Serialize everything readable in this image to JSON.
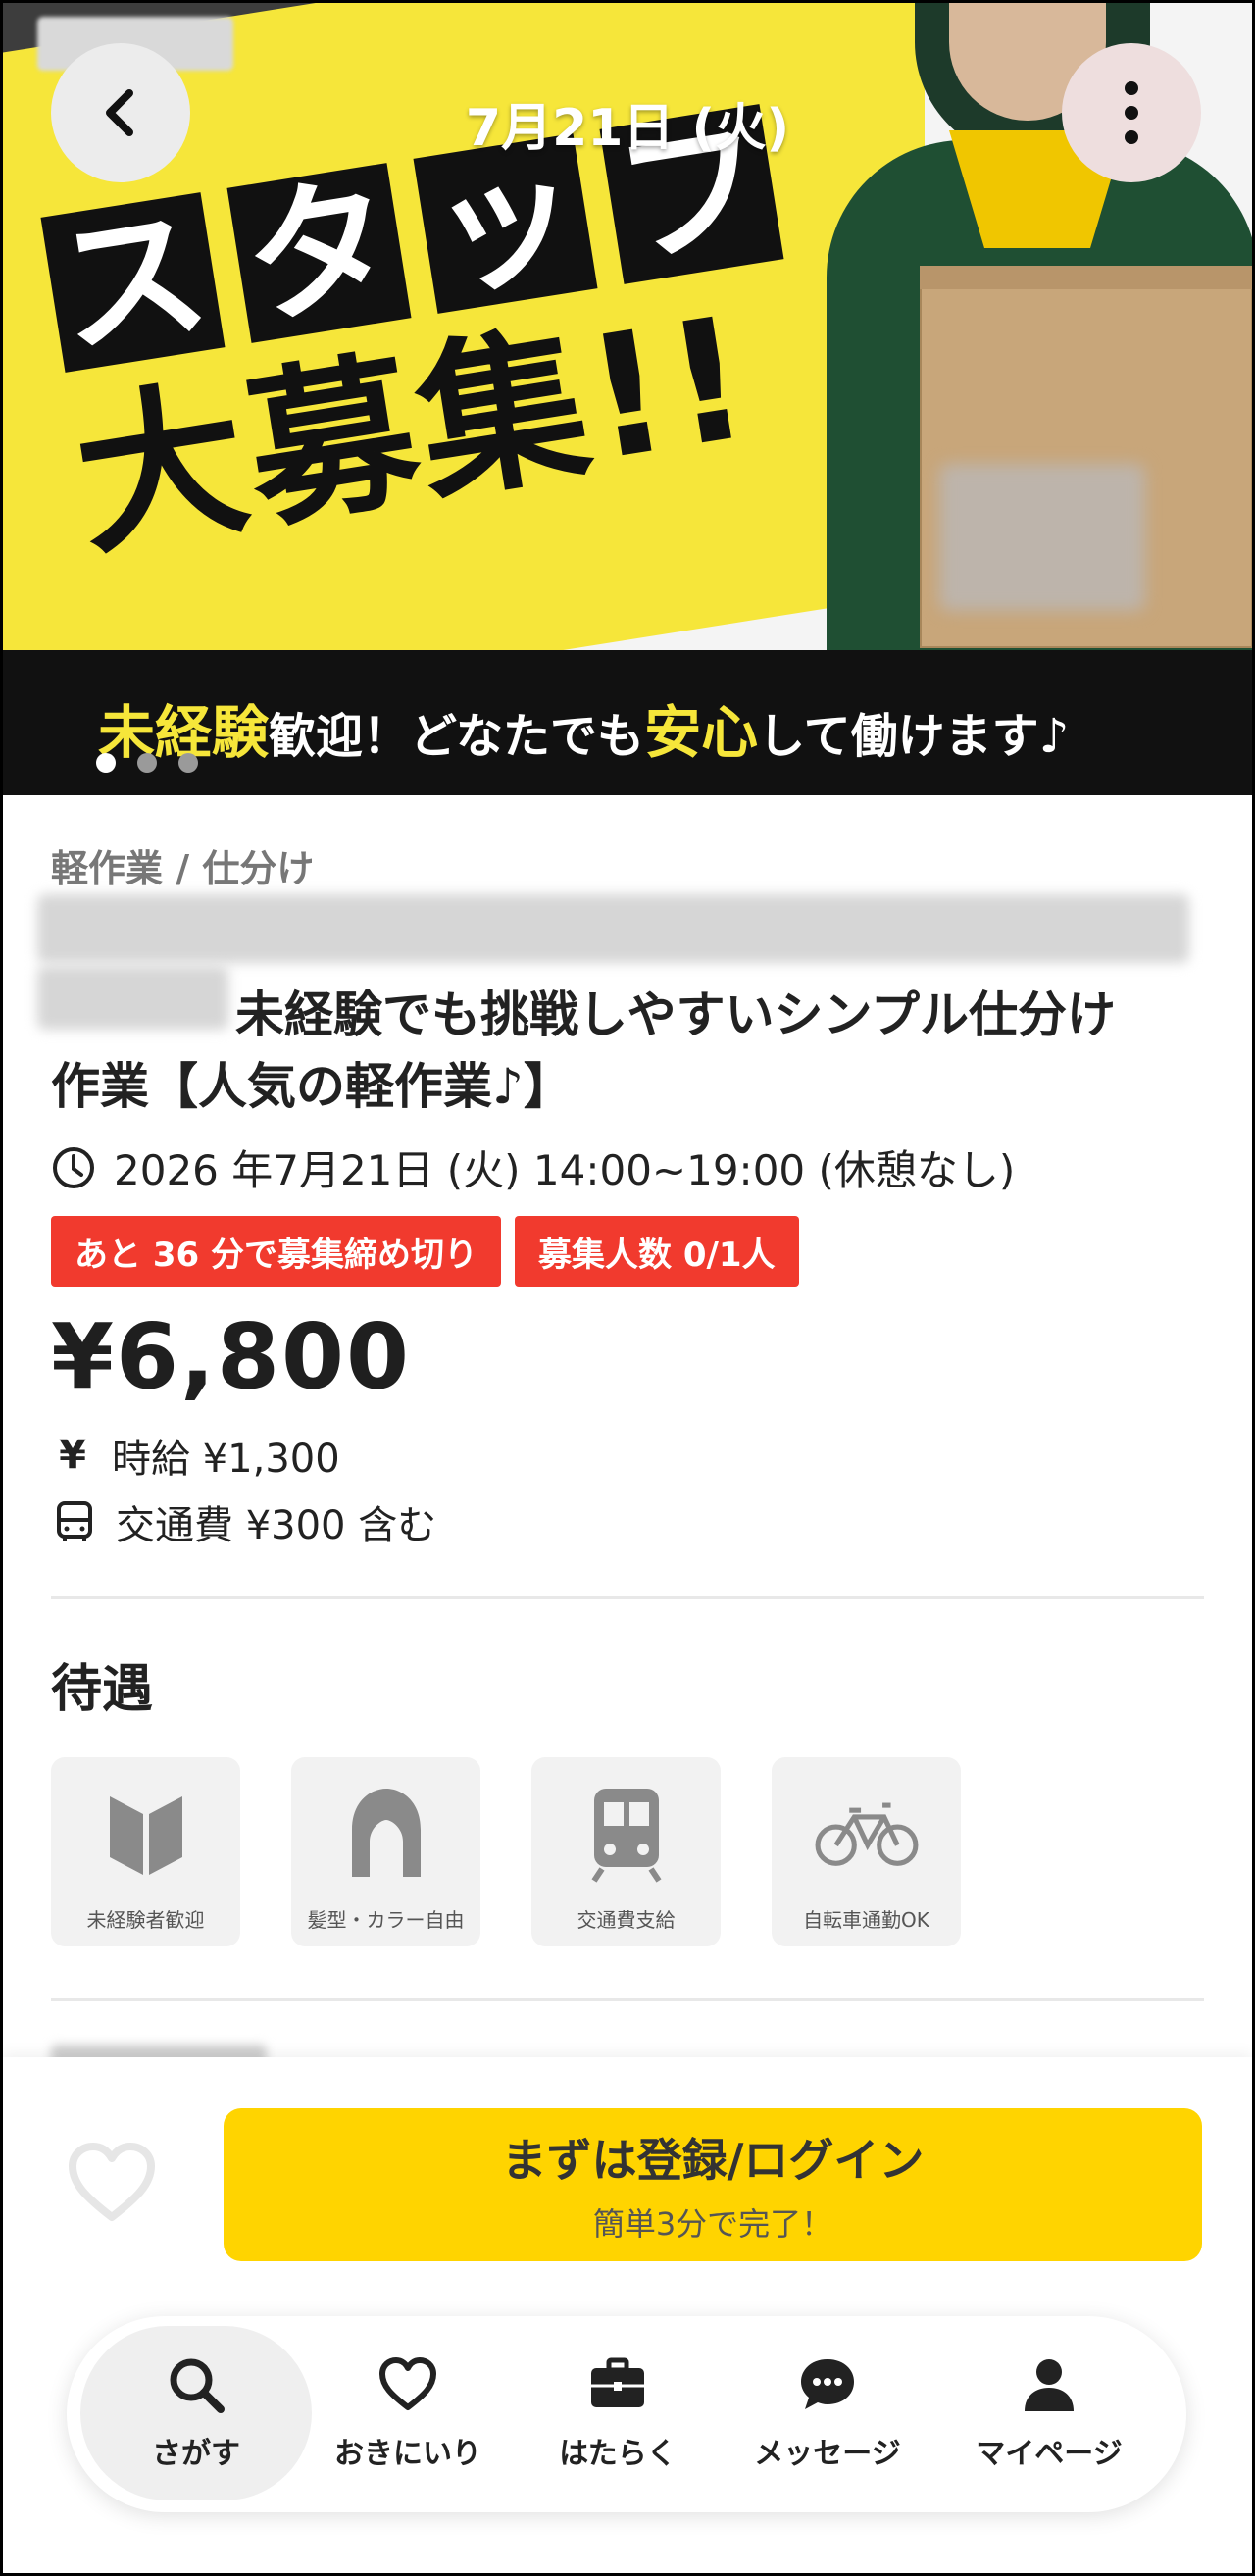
{
  "hero": {
    "date_title": "7月21日 (火)",
    "headline_kana": [
      "ス",
      "タ",
      "ッ",
      "フ"
    ],
    "headline_sub": "大募集!!",
    "banner": {
      "hl1": "未経験",
      "part1": "歓迎！どなたでも",
      "hl2": "安心",
      "part2": "して働けます♪"
    },
    "slide_count": 3,
    "active_slide": 1,
    "back_icon": "chevron-left-icon",
    "more_icon": "more-vertical-icon"
  },
  "job": {
    "category": "軽作業 / 仕分け",
    "title_line1": "未経験でも挑戦しやすいシンプル仕分け",
    "title_line2": "作業【人気の軽作業♪】",
    "datetime": "2026 年7月21日 (火) 14:00~19:00 (休憩なし)",
    "badges": [
      "あと 36 分で募集締め切り",
      "募集人数 0/1人"
    ],
    "price": "¥6,800",
    "hourly": "時給 ¥1,300",
    "transport": "交通費 ¥300 含む"
  },
  "benefits": {
    "title": "待遇",
    "items": [
      {
        "label": "未経験者歓迎",
        "icon": "beginner-mark-icon"
      },
      {
        "label": "髪型・カラー自由",
        "icon": "hair-icon"
      },
      {
        "label": "交通費支給",
        "icon": "train-icon"
      },
      {
        "label": "自転車通勤OK",
        "icon": "bicycle-icon"
      }
    ]
  },
  "actions": {
    "cta_main": "まずは登録/ログイン",
    "cta_sub": "簡単3分で完了！"
  },
  "nav": {
    "items": [
      {
        "label": "さがす",
        "icon": "search-icon",
        "active": true
      },
      {
        "label": "おきにいり",
        "icon": "heart-icon",
        "active": false
      },
      {
        "label": "はたらく",
        "icon": "briefcase-icon",
        "active": false
      },
      {
        "label": "メッセージ",
        "icon": "message-icon",
        "active": false
      },
      {
        "label": "マイページ",
        "icon": "user-icon",
        "active": false
      }
    ]
  },
  "colors": {
    "accent_yellow": "#ffd400",
    "badge_red": "#f13a2e",
    "hero_yellow": "#f6e63a"
  }
}
